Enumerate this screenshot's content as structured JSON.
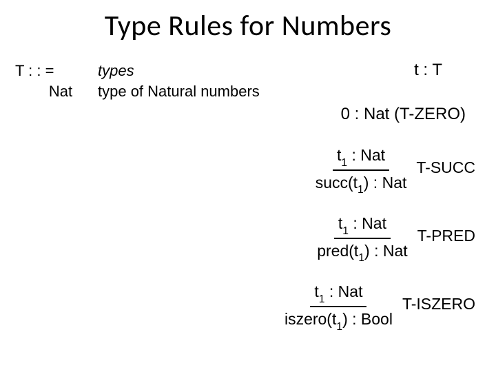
{
  "title": "Type Rules for Numbers",
  "grammar": {
    "lhs1": "T : : =",
    "desc1": "types",
    "lhs2": "        Nat",
    "desc2": "type of Natural numbers"
  },
  "judgement": "t : T",
  "axiom": "0 : Nat (T-ZERO)",
  "rules": {
    "succ": {
      "premise_pre": "t",
      "premise_sub": "1",
      "premise_post": " : Nat",
      "concl_pre": "succ(t",
      "concl_sub": "1",
      "concl_post": ") : Nat",
      "name": "T-SUCC"
    },
    "pred": {
      "premise_pre": "t",
      "premise_sub": "1",
      "premise_post": " : Nat",
      "concl_pre": "pred(t",
      "concl_sub": "1",
      "concl_post": ") : Nat",
      "name": "T-PRED"
    },
    "iszero": {
      "premise_pre": "t",
      "premise_sub": "1",
      "premise_post": " : Nat",
      "concl_pre": "iszero(t",
      "concl_sub": "1",
      "concl_post": ") : Bool",
      "name": "T-ISZERO"
    }
  }
}
